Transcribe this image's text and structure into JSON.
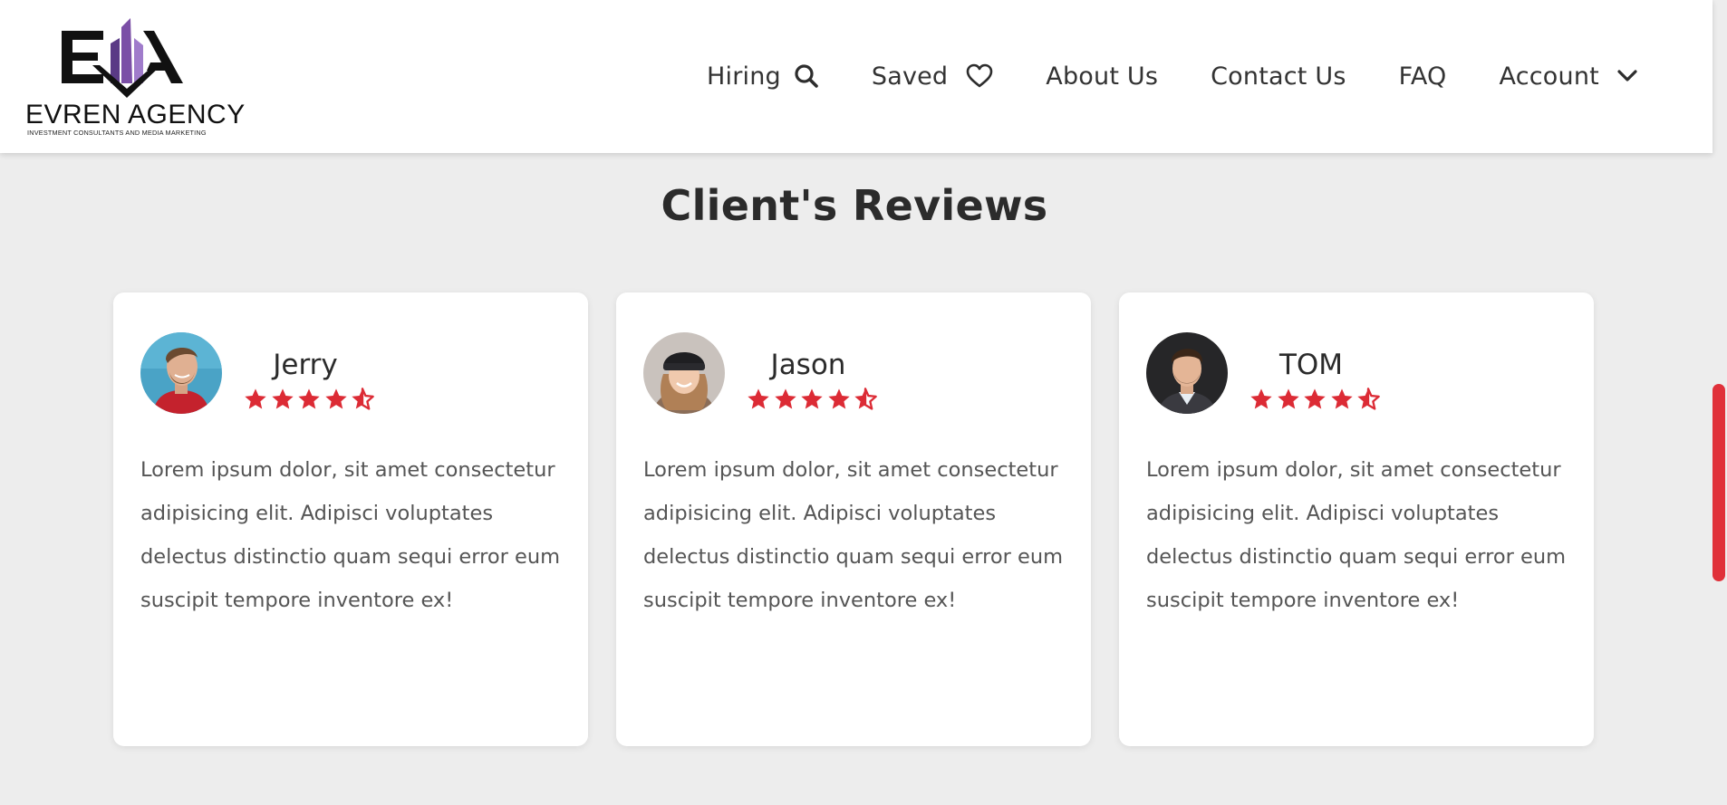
{
  "brand": {
    "name": "EVREN AGENCY",
    "tagline": "INVESTMENT CONSULTANTS AND MEDIA MARKETING",
    "colors": {
      "ink": "#111111",
      "accent": "#7b4fa6"
    }
  },
  "nav": {
    "items": [
      {
        "label": "Hiring",
        "icon": "search-icon"
      },
      {
        "label": "Saved",
        "icon": "heart-icon"
      },
      {
        "label": "About Us"
      },
      {
        "label": "Contact Us"
      },
      {
        "label": "FAQ"
      },
      {
        "label": "Account",
        "icon": "chevron-down-icon"
      }
    ]
  },
  "section": {
    "title": "Client's Reviews"
  },
  "reviews": [
    {
      "name": "Jerry",
      "rating": 4.5,
      "text": "Lorem ipsum dolor, sit amet consectetur adipisicing elit. Adipisci voluptates delectus distinctio quam sequi error eum suscipit tempore inventore ex!"
    },
    {
      "name": "Jason",
      "rating": 4.5,
      "text": "Lorem ipsum dolor, sit amet consectetur adipisicing elit. Adipisci voluptates delectus distinctio quam sequi error eum suscipit tempore inventore ex!"
    },
    {
      "name": "TOM",
      "rating": 4.5,
      "text": "Lorem ipsum dolor, sit amet consectetur adipisicing elit. Adipisci voluptates delectus distinctio quam sequi error eum suscipit tempore inventore ex!"
    }
  ],
  "colors": {
    "star": "#dc2b35",
    "scrollbar": "#e0313a",
    "background": "#ededed"
  }
}
